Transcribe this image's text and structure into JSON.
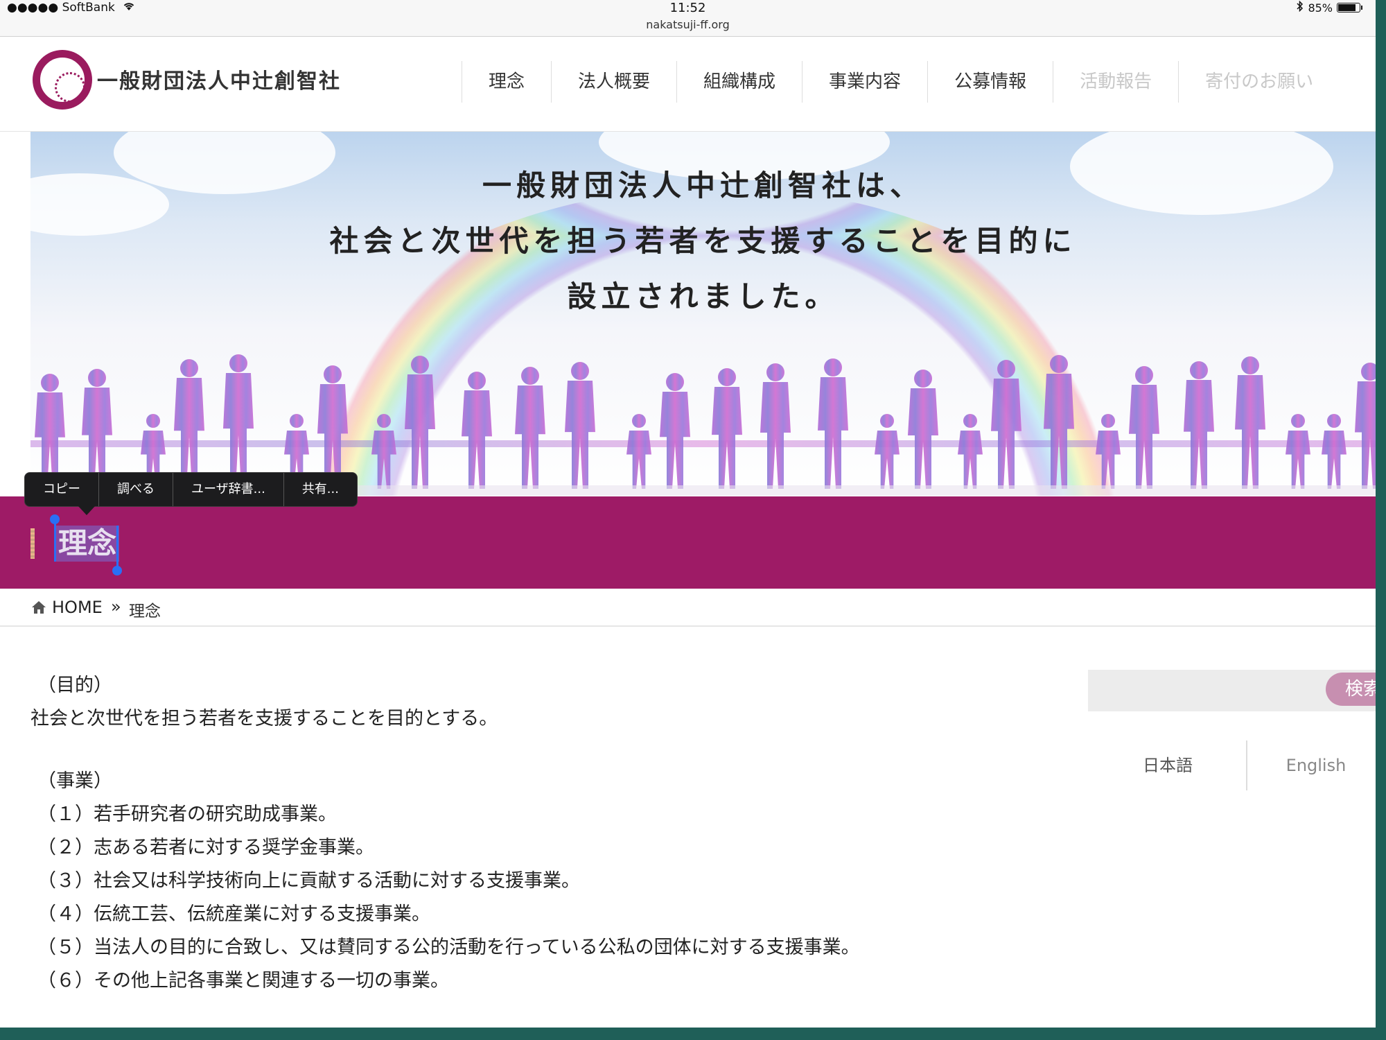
{
  "status_bar": {
    "carrier": "●●●●● SoftBank",
    "time": "11:52",
    "url": "nakatsuji-ff.org",
    "battery": "85%",
    "battery_level": 0.85
  },
  "header": {
    "org_name": "一般財団法人中辻創智社",
    "nav": [
      {
        "label": "理念"
      },
      {
        "label": "法人概要"
      },
      {
        "label": "組織構成"
      },
      {
        "label": "事業内容"
      },
      {
        "label": "公募情報"
      },
      {
        "label": "活動報告"
      },
      {
        "label": "寄付のお願い"
      }
    ]
  },
  "hero": {
    "lines": [
      "一般財団法人中辻創智社は、",
      "社会と次世代を担う若者を支援することを目的に",
      "設立されました。"
    ]
  },
  "context_menu": {
    "items": [
      "コピー",
      "調べる",
      "ユーザ辞書...",
      "共有..."
    ]
  },
  "page_title": "理念",
  "breadcrumb": {
    "home": "HOME",
    "separator": "»",
    "current": "理念"
  },
  "content": {
    "purpose_heading": "（目的）",
    "purpose_text": "社会と次世代を担う若者を支援することを目的とする。",
    "business_heading": "（事業）",
    "business_items": [
      "（１）若手研究者の研究助成事業。",
      "（２）志ある若者に対する奨学金事業。",
      "（３）社会又は科学技術向上に貢献する活動に対する支援事業。",
      "（４）伝統工芸、伝統産業に対する支援事業。",
      "（５）当法人の目的に合致し、又は賛同する公的活動を行っている公私の団体に対する支援事業。",
      "（６）その他上記各事業と関連する一切の事業。"
    ]
  },
  "sidebar": {
    "search_button": "検索",
    "lang_ja": "日本語",
    "lang_en": "English"
  },
  "colors": {
    "brand": "#9e1b66",
    "selection": "#2a6ff5",
    "search_button": "#c78fb0"
  }
}
